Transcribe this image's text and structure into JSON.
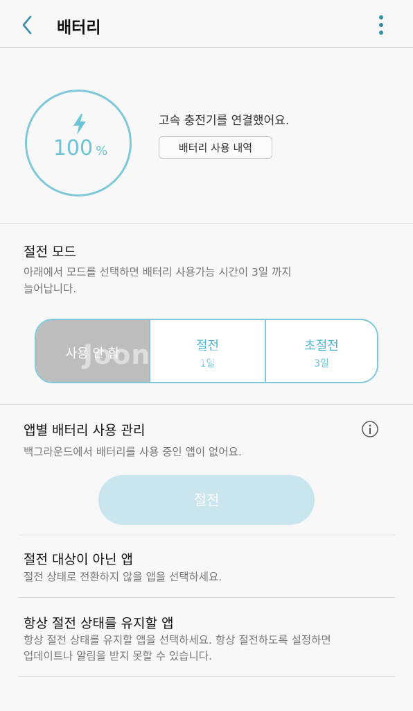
{
  "appbar": {
    "title": "배터리"
  },
  "battery": {
    "level": 100,
    "level_text": "100",
    "unit": "%",
    "charger_status": "고속 충전기를 연결했어요.",
    "usage_button": "배터리 사용 내역"
  },
  "power_saving": {
    "title": "절전 모드",
    "description_line1": "아래에서 모드를 선택하면 배터리 사용가능 시간이 3일 까지",
    "description_line2": "늘어납니다.",
    "modes": [
      {
        "label": "사용 안 함",
        "sub": ""
      },
      {
        "label": "절전",
        "sub": "1일"
      },
      {
        "label": "초절전",
        "sub": "3일"
      }
    ],
    "selected": "사용 안 함",
    "watermark": "Joongonara"
  },
  "app_management": {
    "title": "앱별 배터리 사용 관리",
    "description": "백그라운드에서 배터리를 사용 중인 앱이 없어요.",
    "save_button": "절전",
    "items": [
      {
        "title": "절전 대상이 아닌 앱",
        "desc_line1": "절전 상태로 전환하지 않을 앱을 선택하세요.",
        "desc_line2": ""
      },
      {
        "title": "항상 절전 상태를 유지할 앱",
        "desc_line1": "항상 절전 상태를 유지할 앱을 선택하세요. 항상 절전하도록 설정하면",
        "desc_line2": "업데이트나 알림을 받지 못할 수 있습니다."
      }
    ]
  },
  "colors": {
    "accent": "#7ec8da",
    "accent_text": "#4ab7d3",
    "selected_bg": "#bdbdbd",
    "disabled_button": "#c9e6ef",
    "back_icon": "#3a8fa8"
  },
  "icons": {
    "back": "chevron-left-icon",
    "more": "more-vertical-icon",
    "bolt": "lightning-bolt-icon",
    "info": "info-circle-icon"
  }
}
